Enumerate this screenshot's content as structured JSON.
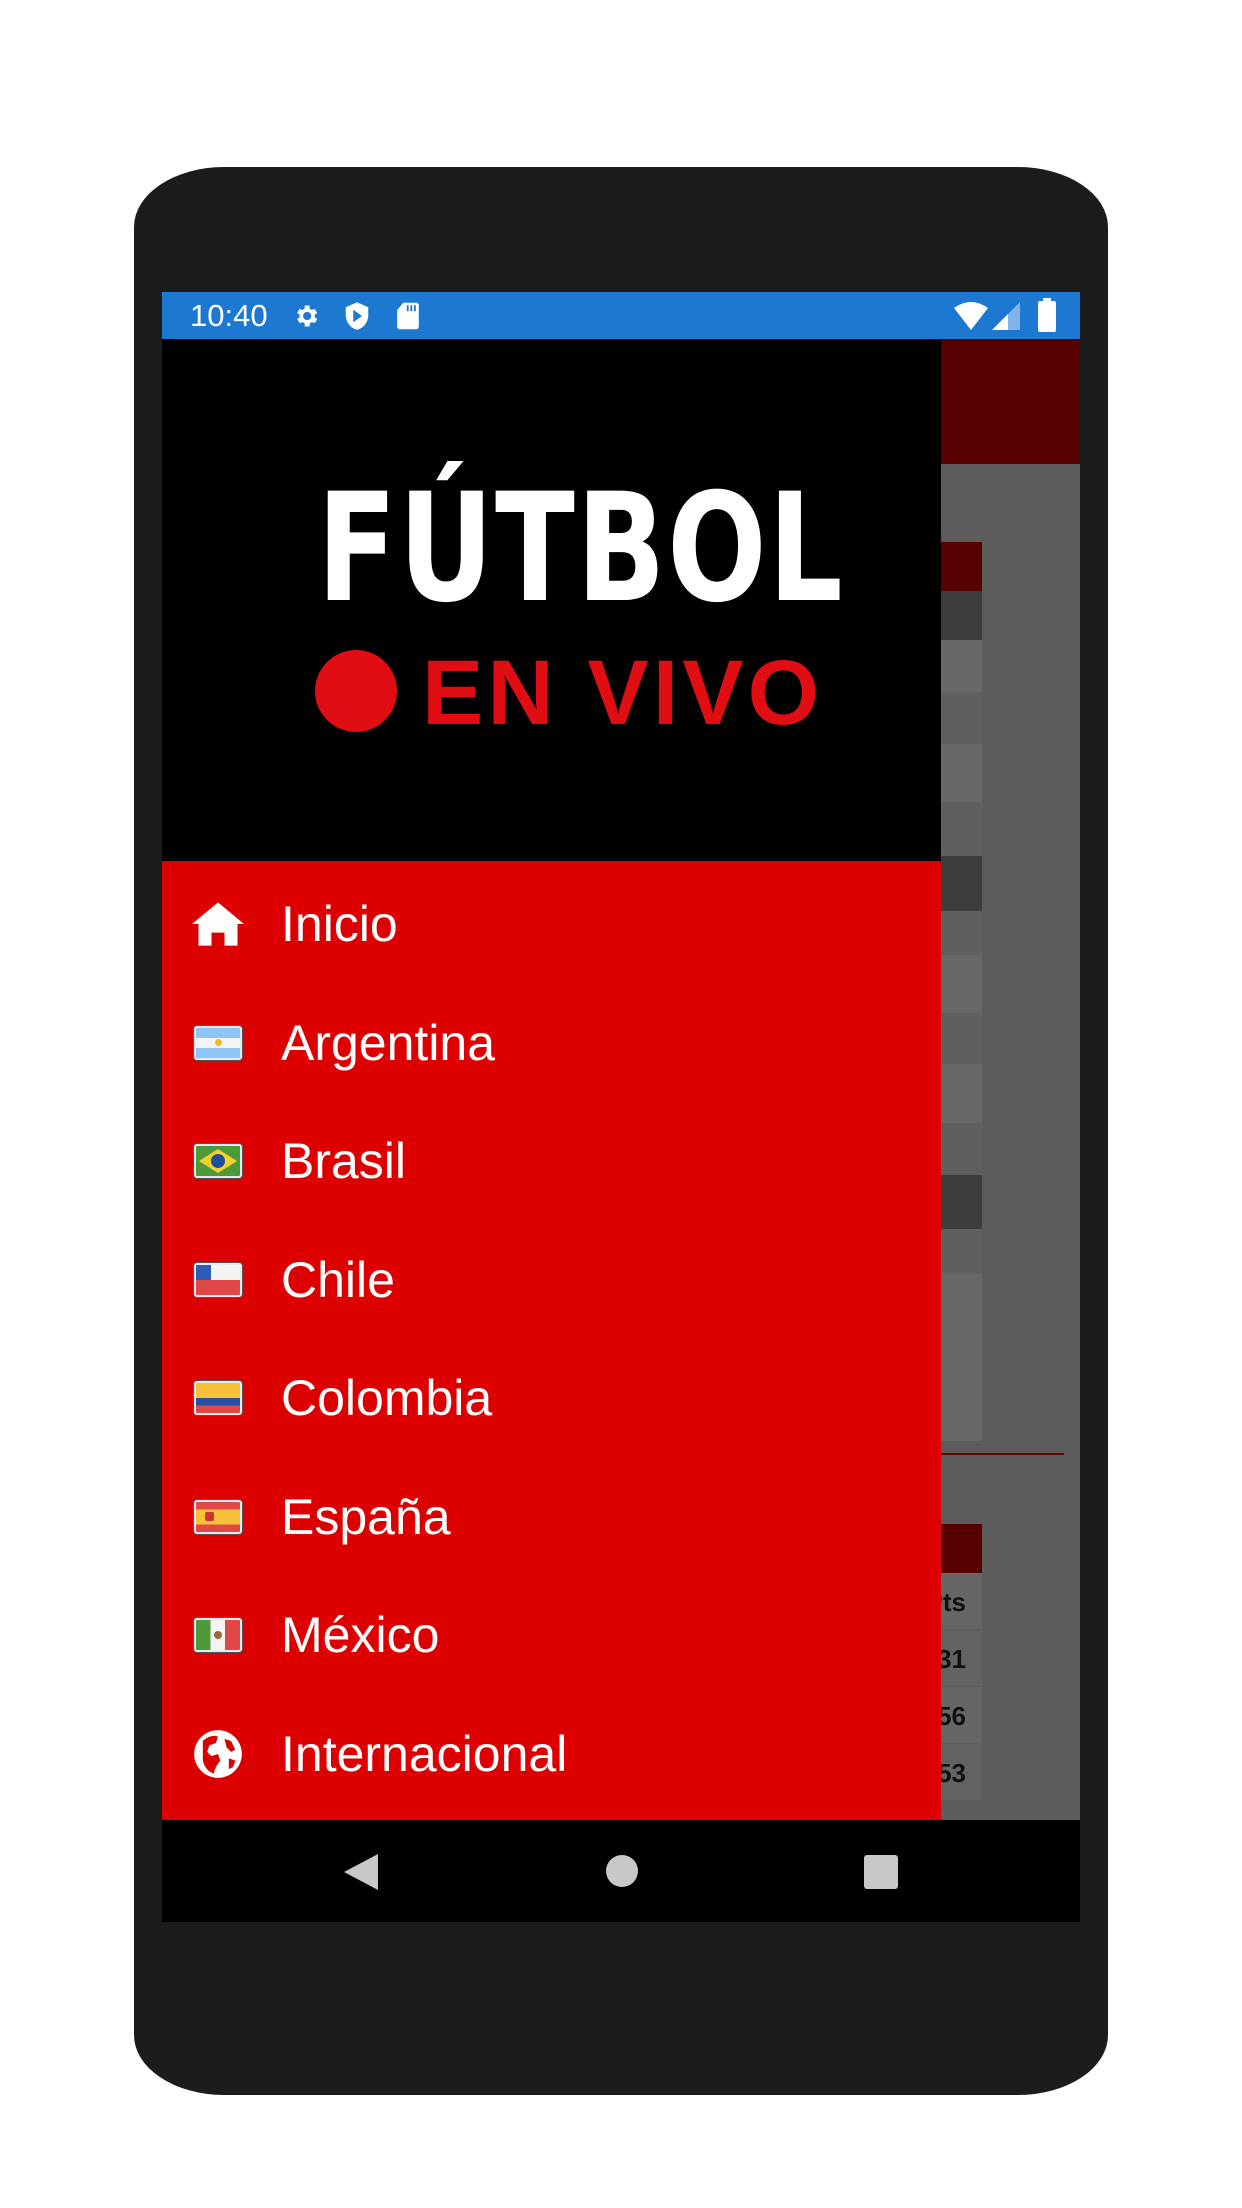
{
  "status_bar": {
    "time": "10:40",
    "icons": [
      "gear-icon",
      "shield-play-icon",
      "sd-card-icon",
      "wifi-icon",
      "signal-icon",
      "battery-icon"
    ]
  },
  "logo": {
    "line1": "FÚTBOL",
    "line2": "EN VIVO"
  },
  "menu": {
    "items": [
      {
        "label": "Inicio",
        "icon": "home-icon"
      },
      {
        "label": "Argentina",
        "icon": "flag-argentina-icon"
      },
      {
        "label": "Brasil",
        "icon": "flag-brasil-icon"
      },
      {
        "label": "Chile",
        "icon": "flag-chile-icon"
      },
      {
        "label": "Colombia",
        "icon": "flag-colombia-icon"
      },
      {
        "label": "España",
        "icon": "flag-espana-icon"
      },
      {
        "label": "México",
        "icon": "flag-mexico-icon"
      },
      {
        "label": "Internacional",
        "icon": "globe-icon"
      }
    ]
  },
  "background_table": {
    "header": "Pts",
    "values": [
      "31",
      "56",
      "53"
    ]
  },
  "colors": {
    "status_bar": "#1c78d0",
    "drawer_menu": "#dc0000",
    "drawer_header": "#000000",
    "logo_red": "#e00d13"
  }
}
